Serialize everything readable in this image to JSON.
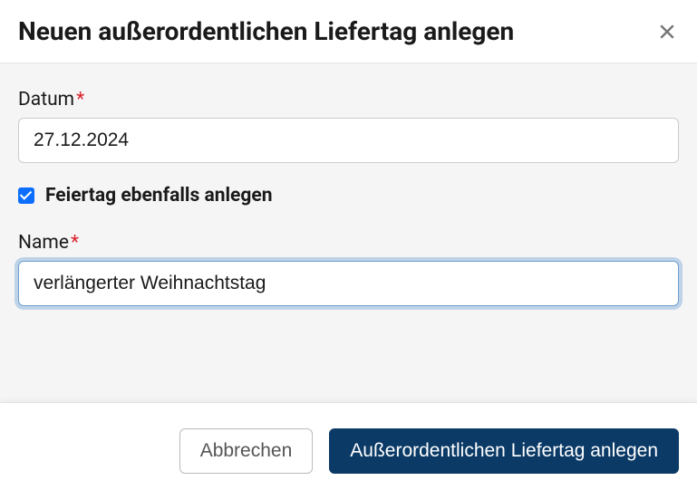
{
  "modal": {
    "title": "Neuen außerordentlichen Liefertag anlegen"
  },
  "form": {
    "dateLabel": "Datum",
    "dateValue": "27.12.2024",
    "checkboxLabel": "Feiertag ebenfalls anlegen",
    "checkboxChecked": true,
    "nameLabel": "Name",
    "nameValue": "verlängerter Weihnachtstag"
  },
  "footer": {
    "cancel": "Abbrechen",
    "submit": "Außerordentlichen Liefertag anlegen"
  },
  "required": "*"
}
